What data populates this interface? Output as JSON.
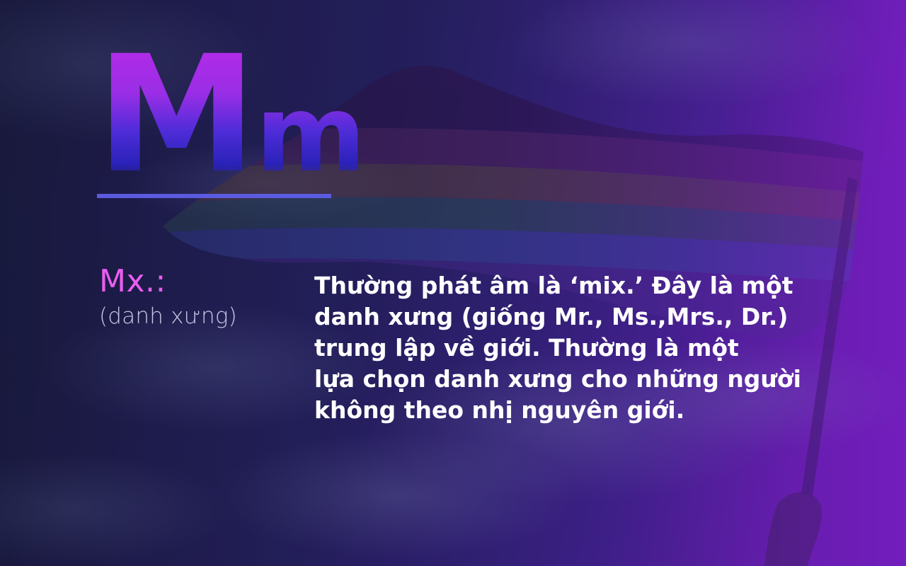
{
  "heading": {
    "upper": "M",
    "lower": "m"
  },
  "entry": {
    "term": "Mx.:",
    "part_of_speech": "(danh xưng)",
    "definition_lines": [
      "Thường phát âm là ‘mix.’ Đây là một",
      "danh xưng (giống Mr., Ms.,Mrs., Dr.)",
      "trung lập về giới. Thường là một",
      "lựa chọn danh xưng cho những người",
      "không theo nhị nguyên giới."
    ]
  },
  "colors": {
    "background_dark": "#1c1d47",
    "background_purple": "#6a1bb0",
    "heading_gradient_top": "#b42be8",
    "heading_gradient_bottom": "#2a22b8",
    "divider": "#5b5be0",
    "term": "#e85ef0",
    "part_of_speech": "#c9c6e6",
    "definition": "#ffffff"
  },
  "background_image": "pride-flag-waving-against-cloudy-sky"
}
